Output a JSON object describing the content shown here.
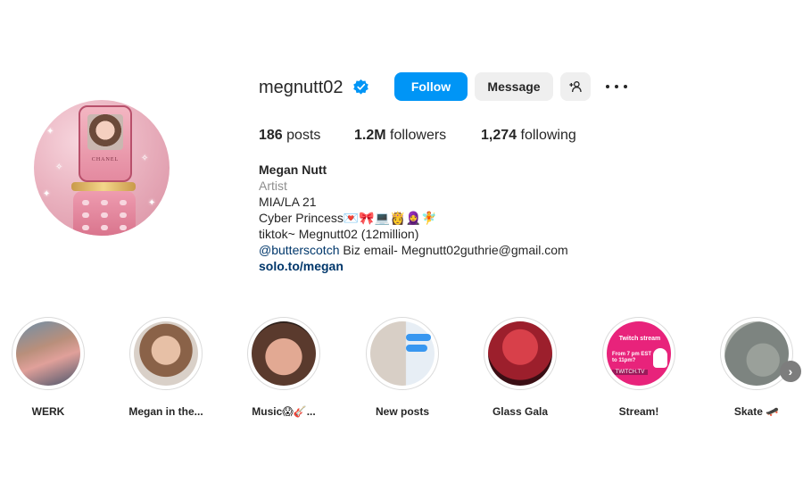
{
  "profile": {
    "username": "megnutt02",
    "verified_icon": "verified-badge-icon",
    "follow_label": "Follow",
    "message_label": "Message",
    "suggest_icon": "add-person-icon",
    "more_icon": "more-options-icon",
    "avatar_icon": "profile-avatar"
  },
  "stats": {
    "posts_count": "186",
    "posts_label": "posts",
    "followers_count": "1.2M",
    "followers_label": "followers",
    "following_count": "1,274",
    "following_label": "following"
  },
  "bio": {
    "name": "Megan Nutt",
    "category": "Artist",
    "line1": "MIA/LA 21",
    "line2": "Cyber Princess💌🎀💻👸🧕🧚",
    "line3": "tiktok~ Megnutt02 (12million)",
    "mention": "@butterscotch",
    "email_text": " Biz email- Megnutt02guthrie@gmail.com",
    "link": "solo.to/megan"
  },
  "highlights": [
    {
      "label": "WERK",
      "icon": "highlight-werk"
    },
    {
      "label": "Megan in the...",
      "icon": "highlight-megan-in-the"
    },
    {
      "label": "Music😱🎸...",
      "icon": "highlight-music"
    },
    {
      "label": "New posts",
      "icon": "highlight-new-posts"
    },
    {
      "label": "Glass Gala",
      "icon": "highlight-glass-gala"
    },
    {
      "label": "Stream!",
      "icon": "highlight-stream"
    },
    {
      "label": "Skate 🛹",
      "icon": "highlight-skate"
    }
  ],
  "stream_highlight_text": {
    "line1": "Twitch stream",
    "line2": "From 7 pm EST to 11pm?",
    "line3": "TWITCH.TV"
  },
  "colors": {
    "accent": "#0095f6",
    "secondary_button": "#efefef",
    "link": "#00376b",
    "muted": "#8e8e8e"
  },
  "next_icon": "chevron-right-icon"
}
